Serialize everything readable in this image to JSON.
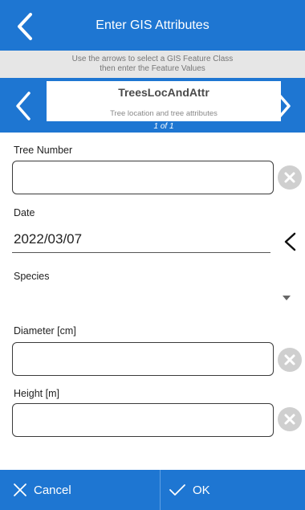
{
  "header": {
    "title": "Enter GIS Attributes",
    "back_icon": "chevron-left-icon"
  },
  "instructions": {
    "line1": "Use the arrows to select a GIS Feature Class",
    "line2": "then enter the Feature Values"
  },
  "feature_class": {
    "name": "TreesLocAndAttr",
    "description": "Tree location and tree attributes",
    "count": "1 of 1"
  },
  "fields": {
    "tree_number": {
      "label": "Tree Number",
      "value": ""
    },
    "date": {
      "label": "Date",
      "value": "2022/03/07"
    },
    "species": {
      "label": "Species",
      "value": ""
    },
    "diameter": {
      "label": "Diameter [cm]",
      "value": ""
    },
    "height": {
      "label": "Height [m]",
      "value": ""
    }
  },
  "footer": {
    "cancel_label": "Cancel",
    "ok_label": "OK"
  },
  "colors": {
    "accent": "#1e76d2",
    "instruction_bg": "#e6e6e6",
    "clear_icon": "#cfcfcf"
  }
}
